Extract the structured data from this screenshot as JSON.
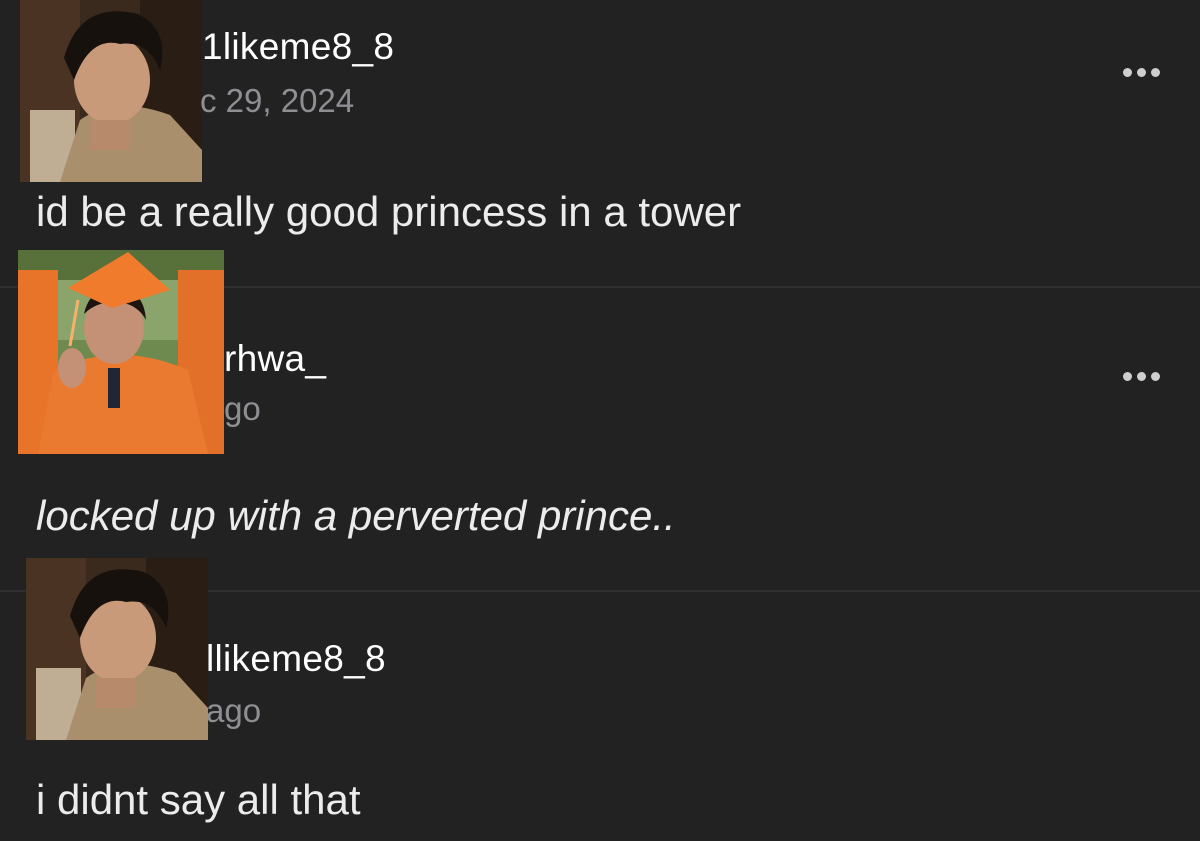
{
  "comments": [
    {
      "username": "1likeme8_8",
      "timestamp": "c 29, 2024",
      "text": "id be a really good princess in a tower",
      "italic": false,
      "avatar_icon": "user-avatar-photo"
    },
    {
      "username": "rhwa_",
      "timestamp": "go",
      "text": "locked up with a perverted prince..",
      "italic": true,
      "avatar_icon": "user-avatar-photo-graduation"
    },
    {
      "username": "llikeme8_8",
      "timestamp": "ago",
      "text": "i didnt say all that",
      "italic": false,
      "avatar_icon": "user-avatar-photo"
    }
  ],
  "more_options_icon": "more-horizontal-icon",
  "colors": {
    "background": "#222223",
    "username": "#ffffff",
    "timestamp": "#8f8f93",
    "body_text": "#ececec",
    "graduation_accent": "#e8742a"
  }
}
